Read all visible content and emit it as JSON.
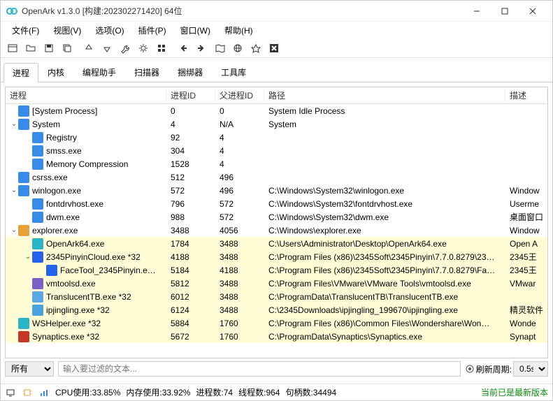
{
  "window": {
    "title": "OpenArk v1.3.0 [构建:202302271420]  64位"
  },
  "menu": {
    "file": "文件(F)",
    "view": "视图(V)",
    "options": "选项(O)",
    "plugins": "插件(P)",
    "window": "窗口(W)",
    "help": "帮助(H)"
  },
  "tabs": {
    "process": "进程",
    "kernel": "内核",
    "codehelper": "编程助手",
    "scanner": "扫描器",
    "bundler": "捆绑器",
    "toolkit": "工具库"
  },
  "columns": {
    "process": "进程",
    "pid": "进程ID",
    "ppid": "父进程ID",
    "path": "路径",
    "desc": "描述"
  },
  "rows": [
    {
      "indent": 0,
      "exp": "",
      "icon": "#3a8ae8",
      "name": "[System Process]",
      "pid": "0",
      "ppid": "0",
      "path": "System Idle Process",
      "desc": "",
      "hl": false
    },
    {
      "indent": 0,
      "exp": "⌄",
      "icon": "#3a8ae8",
      "name": "System",
      "pid": "4",
      "ppid": "N/A",
      "path": "System",
      "desc": "",
      "hl": false
    },
    {
      "indent": 1,
      "exp": "",
      "icon": "#3a8ae8",
      "name": "Registry",
      "pid": "92",
      "ppid": "4",
      "path": "",
      "desc": "",
      "hl": false
    },
    {
      "indent": 1,
      "exp": "",
      "icon": "#3a8ae8",
      "name": "smss.exe",
      "pid": "304",
      "ppid": "4",
      "path": "",
      "desc": "",
      "hl": false
    },
    {
      "indent": 1,
      "exp": "",
      "icon": "#3a8ae8",
      "name": "Memory Compression",
      "pid": "1528",
      "ppid": "4",
      "path": "",
      "desc": "",
      "hl": false
    },
    {
      "indent": 0,
      "exp": "",
      "icon": "#3a8ae8",
      "name": "csrss.exe",
      "pid": "512",
      "ppid": "496",
      "path": "",
      "desc": "",
      "hl": false
    },
    {
      "indent": 0,
      "exp": "⌄",
      "icon": "#3a8ae8",
      "name": "winlogon.exe",
      "pid": "572",
      "ppid": "496",
      "path": "C:\\Windows\\System32\\winlogon.exe",
      "desc": "Window",
      "hl": false
    },
    {
      "indent": 1,
      "exp": "",
      "icon": "#3a8ae8",
      "name": "fontdrvhost.exe",
      "pid": "796",
      "ppid": "572",
      "path": "C:\\Windows\\System32\\fontdrvhost.exe",
      "desc": "Userme",
      "hl": false
    },
    {
      "indent": 1,
      "exp": "",
      "icon": "#3a8ae8",
      "name": "dwm.exe",
      "pid": "988",
      "ppid": "572",
      "path": "C:\\Windows\\System32\\dwm.exe",
      "desc": "桌面窗口",
      "hl": false
    },
    {
      "indent": 0,
      "exp": "⌄",
      "icon": "#e8a23a",
      "name": "explorer.exe",
      "pid": "3488",
      "ppid": "4056",
      "path": "C:\\Windows\\explorer.exe",
      "desc": "Window",
      "hl": false
    },
    {
      "indent": 1,
      "exp": "",
      "icon": "#2ab5c7",
      "name": "OpenArk64.exe",
      "pid": "1784",
      "ppid": "3488",
      "path": "C:\\Users\\Administrator\\Desktop\\OpenArk64.exe",
      "desc": "Open A",
      "hl": true
    },
    {
      "indent": 1,
      "exp": "⌄",
      "icon": "#2563eb",
      "name": "2345PinyinCloud.exe *32",
      "pid": "4188",
      "ppid": "3488",
      "path": "C:\\Program Files (x86)\\2345Soft\\2345Pinyin\\7.7.0.8279\\23…",
      "desc": "2345王",
      "hl": true
    },
    {
      "indent": 2,
      "exp": "",
      "icon": "#2563eb",
      "name": "FaceTool_2345Pinyin.e…",
      "pid": "5184",
      "ppid": "4188",
      "path": "C:\\Program Files (x86)\\2345Soft\\2345Pinyin\\7.7.0.8279\\Fa…",
      "desc": "2345王",
      "hl": true
    },
    {
      "indent": 1,
      "exp": "",
      "icon": "#7b61c4",
      "name": "vmtoolsd.exe",
      "pid": "5812",
      "ppid": "3488",
      "path": "C:\\Program Files\\VMware\\VMware Tools\\vmtoolsd.exe",
      "desc": "VMwar",
      "hl": true
    },
    {
      "indent": 1,
      "exp": "",
      "icon": "#5aa9e6",
      "name": "TranslucentTB.exe *32",
      "pid": "6012",
      "ppid": "3488",
      "path": "C:\\ProgramData\\TranslucentTB\\TranslucentTB.exe",
      "desc": "",
      "hl": true
    },
    {
      "indent": 1,
      "exp": "",
      "icon": "#4aa3df",
      "name": "ipjingling.exe *32",
      "pid": "6124",
      "ppid": "3488",
      "path": "C:\\2345Downloads\\ipjingling_199670\\ipjingling.exe",
      "desc": "精灵软件",
      "hl": true
    },
    {
      "indent": 0,
      "exp": "",
      "icon": "#2ab5c7",
      "name": "WSHelper.exe *32",
      "pid": "5884",
      "ppid": "1760",
      "path": "C:\\Program Files (x86)\\Common Files\\Wondershare\\Won…",
      "desc": "Wonde",
      "hl": true
    },
    {
      "indent": 0,
      "exp": "",
      "icon": "#c0392b",
      "name": "Synaptics.exe *32",
      "pid": "5672",
      "ppid": "1760",
      "path": "C:\\ProgramData\\Synaptics\\Synaptics.exe",
      "desc": "Synapt",
      "hl": true
    }
  ],
  "filter": {
    "all": "所有",
    "placeholder": "输入要过滤的文本...",
    "refresh_label": "刷新周期:",
    "refresh_value": "0.5s"
  },
  "status": {
    "cpu": "CPU使用:33.85%",
    "mem": "内存使用:33.92%",
    "procs": "进程数:74",
    "threads": "线程数:964",
    "handles": "句柄数:34494",
    "latest": "当前已是最新版本"
  }
}
